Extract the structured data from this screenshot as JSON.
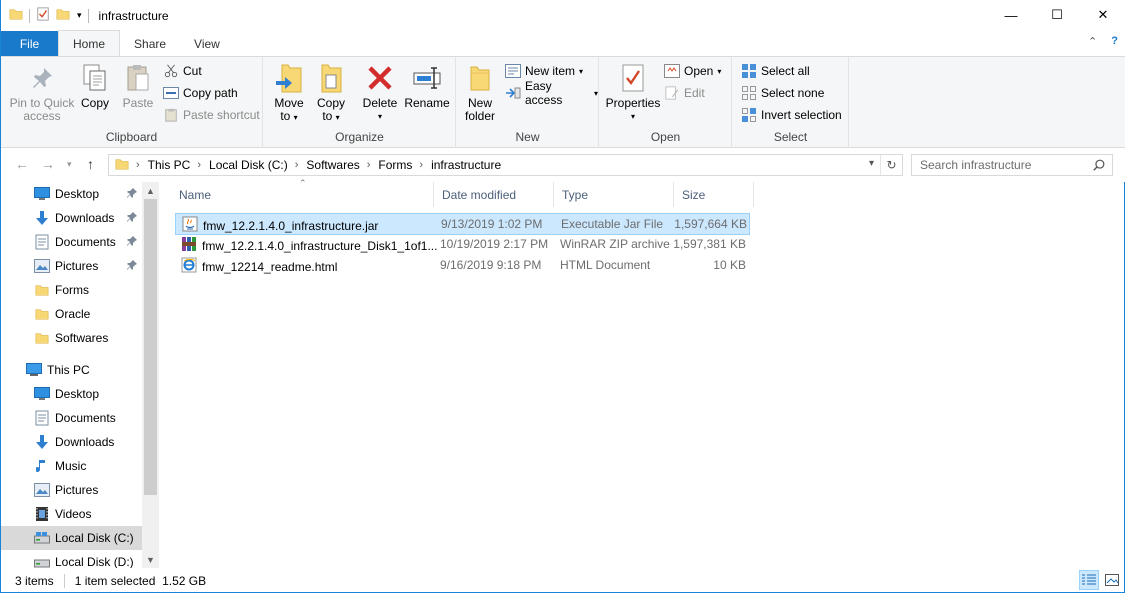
{
  "window": {
    "title": "infrastructure",
    "qat_dropdown": "▾",
    "buttons": {
      "minimize": "—",
      "maximize": "☐",
      "close": "✕"
    }
  },
  "ribbon_tabs": {
    "file": "File",
    "home": "Home",
    "share": "Share",
    "view": "View",
    "collapse": "⌃",
    "help": "?"
  },
  "clipboard": {
    "label": "Clipboard",
    "pin_line1": "Pin to Quick",
    "pin_line2": "access",
    "copy": "Copy",
    "paste": "Paste",
    "cut": "Cut",
    "copy_path": "Copy path",
    "paste_shortcut": "Paste shortcut"
  },
  "organize": {
    "label": "Organize",
    "move_line1": "Move",
    "move_line2": "to",
    "copy_line1": "Copy",
    "copy_line2": "to",
    "delete": "Delete",
    "rename": "Rename"
  },
  "new_group": {
    "label": "New",
    "folder_line1": "New",
    "folder_line2": "folder",
    "new_item": "New item",
    "easy_access": "Easy access"
  },
  "open_group": {
    "label": "Open",
    "properties": "Properties",
    "open": "Open",
    "edit": "Edit"
  },
  "select_group": {
    "label": "Select",
    "select_all": "Select all",
    "select_none": "Select none",
    "invert": "Invert selection"
  },
  "address": {
    "crumbs": [
      "This PC",
      "Local Disk (C:)",
      "Softwares",
      "Forms",
      "infrastructure"
    ],
    "search_placeholder": "Search infrastructure"
  },
  "nav": {
    "quick": [
      {
        "label": "Desktop",
        "icon": "desktop-icon",
        "pinned": true
      },
      {
        "label": "Downloads",
        "icon": "downloads-icon",
        "pinned": true
      },
      {
        "label": "Documents",
        "icon": "documents-icon",
        "pinned": true
      },
      {
        "label": "Pictures",
        "icon": "pictures-icon",
        "pinned": true
      },
      {
        "label": "Forms",
        "icon": "folder-icon",
        "pinned": false
      },
      {
        "label": "Oracle",
        "icon": "folder-icon",
        "pinned": false
      },
      {
        "label": "Softwares",
        "icon": "folder-icon",
        "pinned": false
      }
    ],
    "this_pc": "This PC",
    "pc_items": [
      {
        "label": "Desktop",
        "icon": "desktop-icon"
      },
      {
        "label": "Documents",
        "icon": "documents-icon"
      },
      {
        "label": "Downloads",
        "icon": "downloads-icon"
      },
      {
        "label": "Music",
        "icon": "music-icon"
      },
      {
        "label": "Pictures",
        "icon": "pictures-icon"
      },
      {
        "label": "Videos",
        "icon": "videos-icon"
      },
      {
        "label": "Local Disk (C:)",
        "icon": "drive-icon"
      },
      {
        "label": "Local Disk (D:)",
        "icon": "drive-icon"
      }
    ]
  },
  "columns": {
    "name": "Name",
    "date": "Date modified",
    "type": "Type",
    "size": "Size"
  },
  "files": [
    {
      "name": "fmw_12.2.1.4.0_infrastructure.jar",
      "date": "9/13/2019 1:02 PM",
      "type": "Executable Jar File",
      "size": "1,597,664 KB",
      "icon": "jar-icon",
      "selected": true
    },
    {
      "name": "fmw_12.2.1.4.0_infrastructure_Disk1_1of1....",
      "date": "10/19/2019 2:17 PM",
      "type": "WinRAR ZIP archive",
      "size": "1,597,381 KB",
      "icon": "winrar-icon",
      "selected": false
    },
    {
      "name": "fmw_12214_readme.html",
      "date": "9/16/2019 9:18 PM",
      "type": "HTML Document",
      "size": "10 KB",
      "icon": "html-icon",
      "selected": false
    }
  ],
  "status": {
    "count": "3 items",
    "selection": "1 item selected  1.52 GB"
  },
  "colors": {
    "accent": "#1979ca",
    "selection": "#cce8ff",
    "folder": "#f8d775"
  }
}
